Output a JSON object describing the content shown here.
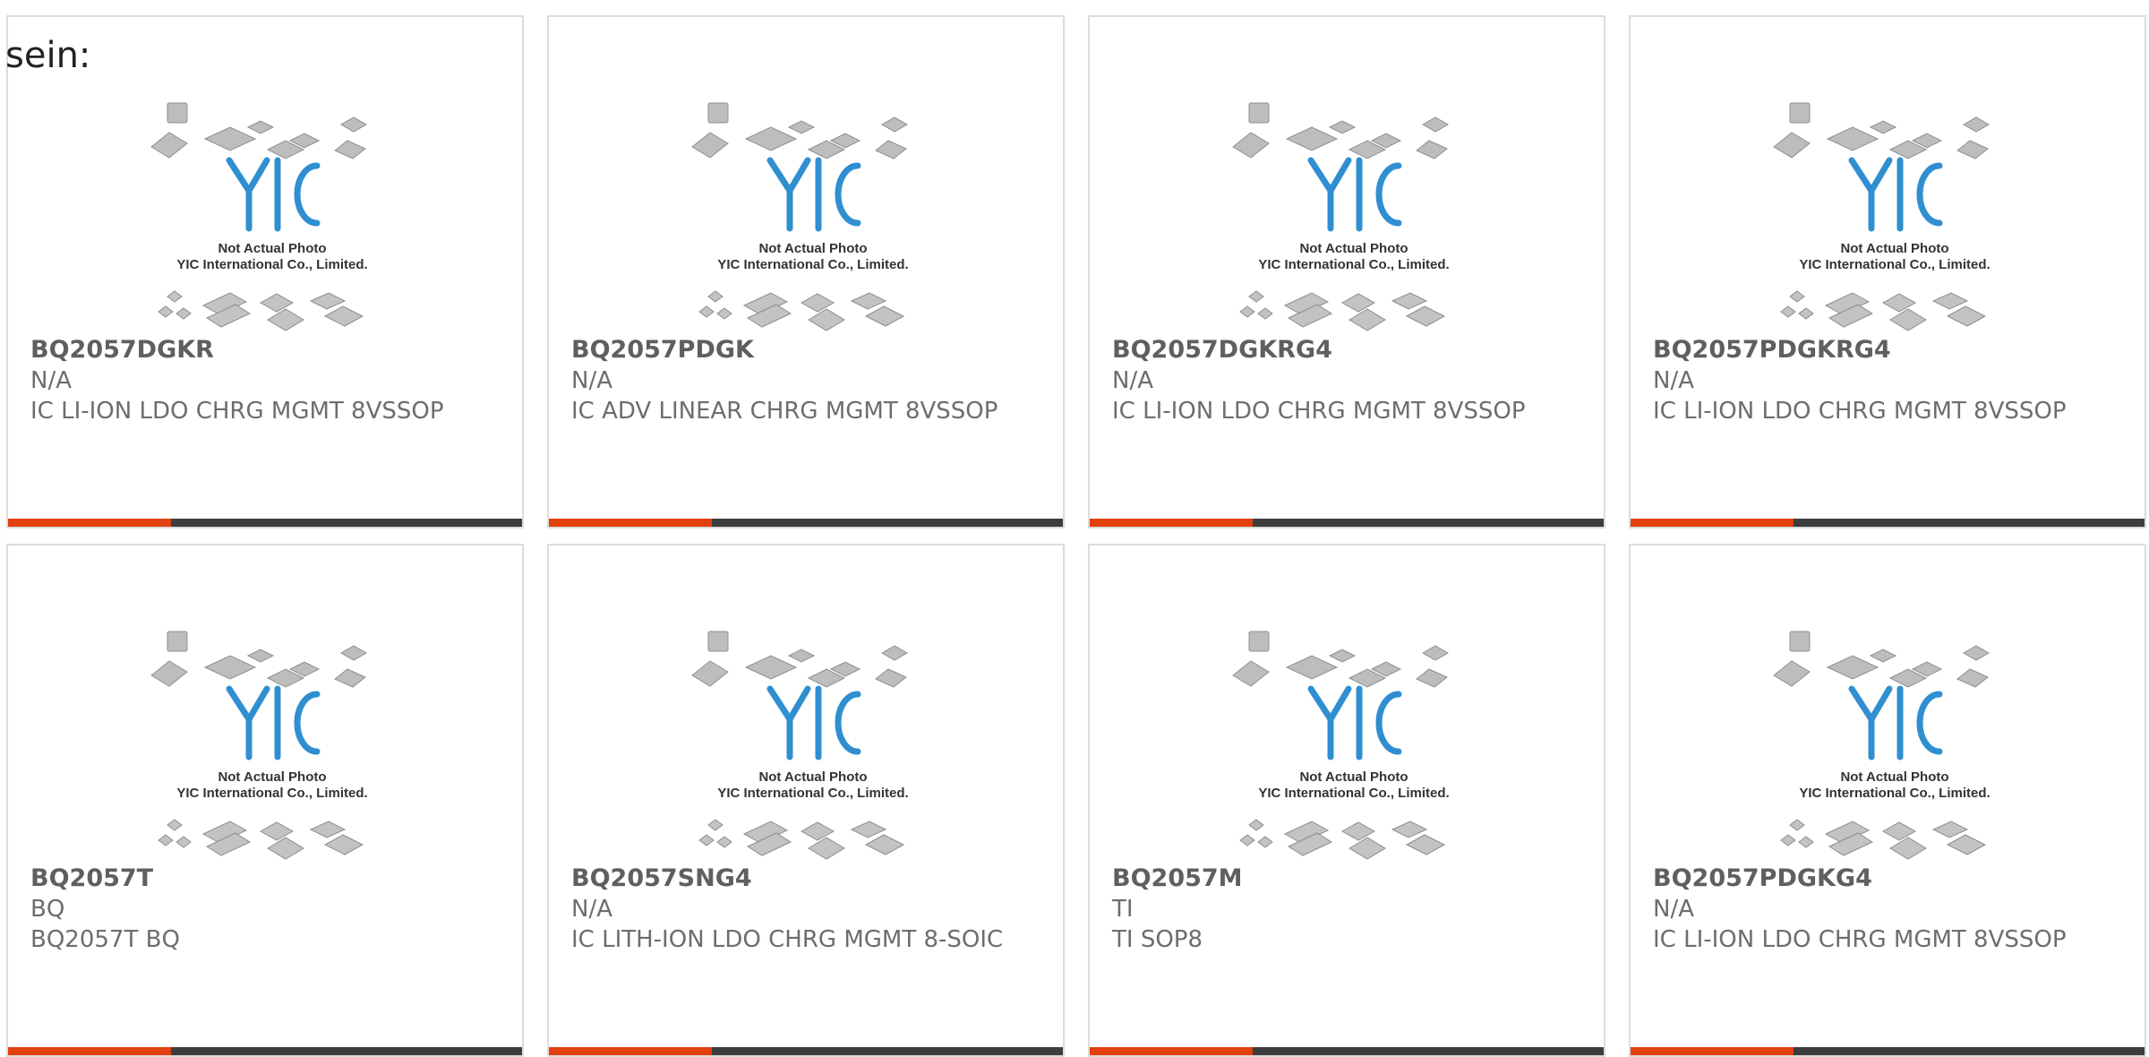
{
  "intro_text": "sein:",
  "image_caption": {
    "line1": "Not Actual Photo",
    "line2": "YIC International Co., Limited."
  },
  "brand": {
    "logo_text": "YIC",
    "logo_color": "#2f8fd0",
    "accent_color": "#e2400f",
    "bar_color": "#3d3d3d"
  },
  "products": [
    {
      "part": "BQ2057DGKR",
      "manufacturer": "N/A",
      "description": "IC LI-ION LDO CHRG MGMT 8VSSOP"
    },
    {
      "part": "BQ2057PDGK",
      "manufacturer": "N/A",
      "description": "IC ADV LINEAR CHRG MGMT 8VSSOP"
    },
    {
      "part": "BQ2057DGKRG4",
      "manufacturer": "N/A",
      "description": "IC LI-ION LDO CHRG MGMT 8VSSOP"
    },
    {
      "part": "BQ2057PDGKRG4",
      "manufacturer": "N/A",
      "description": "IC LI-ION LDO CHRG MGMT 8VSSOP"
    },
    {
      "part": "BQ2057T",
      "manufacturer": "BQ",
      "description": "BQ2057T BQ"
    },
    {
      "part": "BQ2057SNG4",
      "manufacturer": "N/A",
      "description": "IC LITH-ION LDO CHRG MGMT 8-SOIC"
    },
    {
      "part": "BQ2057M",
      "manufacturer": "TI",
      "description": "TI SOP8"
    },
    {
      "part": "BQ2057PDGKG4",
      "manufacturer": "N/A",
      "description": "IC LI-ION LDO CHRG MGMT 8VSSOP"
    }
  ]
}
